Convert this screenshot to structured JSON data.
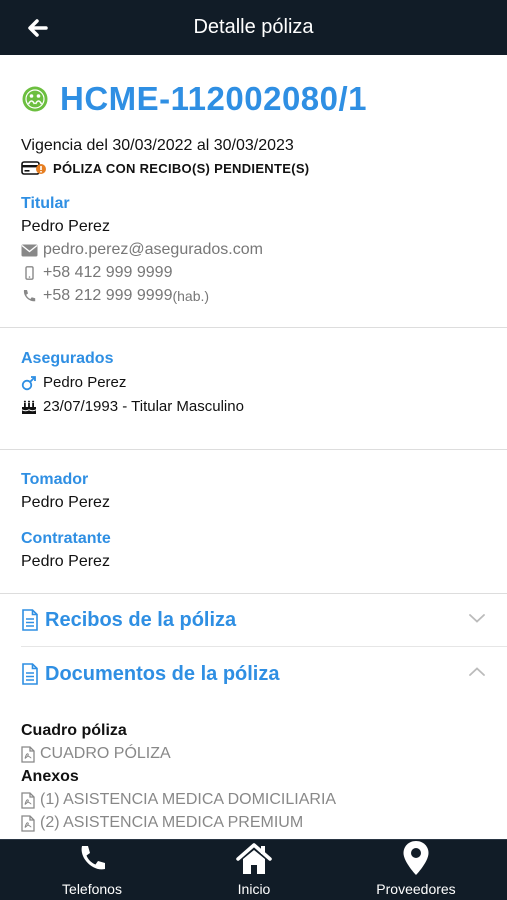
{
  "header": {
    "title": "Detalle póliza"
  },
  "policy": {
    "number": "HCME-112002080/1",
    "vigencia": "Vigencia del 30/03/2022 al 30/03/2023",
    "pending_text": "PÓLIZA CON RECIBO(S) PENDIENTE(S)"
  },
  "titular": {
    "label": "Titular",
    "name": "Pedro Perez",
    "email": "pedro.perez@asegurados.com",
    "mobile": "+58 412 999 9999",
    "phone": "+58 212 999 9999",
    "phone_suffix": "(hab.)"
  },
  "asegurados": {
    "label": "Asegurados",
    "name": "Pedro Perez",
    "detail": "23/07/1993 - Titular Masculino"
  },
  "tomador": {
    "label": "Tomador",
    "name": "Pedro Perez"
  },
  "contratante": {
    "label": "Contratante",
    "name": "Pedro Perez"
  },
  "sections": {
    "recibos": "Recibos de la póliza",
    "documentos": "Documentos de la póliza"
  },
  "documents": {
    "cuadro_heading": "Cuadro póliza",
    "cuadro_item": "CUADRO PÓLIZA",
    "anexos_heading": "Anexos",
    "anexos": [
      "(1) ASISTENCIA MEDICA DOMICILIARIA",
      "(2) ASISTENCIA MEDICA PREMIUM"
    ]
  },
  "tabs": [
    {
      "label": "Telefonos",
      "icon": "phone-icon"
    },
    {
      "label": "Inicio",
      "icon": "home-icon"
    },
    {
      "label": "Proveedores",
      "icon": "map-pin-icon"
    }
  ],
  "colors": {
    "accent": "#2f8fe3",
    "header_bg": "#111c27",
    "status_green": "#6cbf3f",
    "warning": "#e67e22"
  }
}
